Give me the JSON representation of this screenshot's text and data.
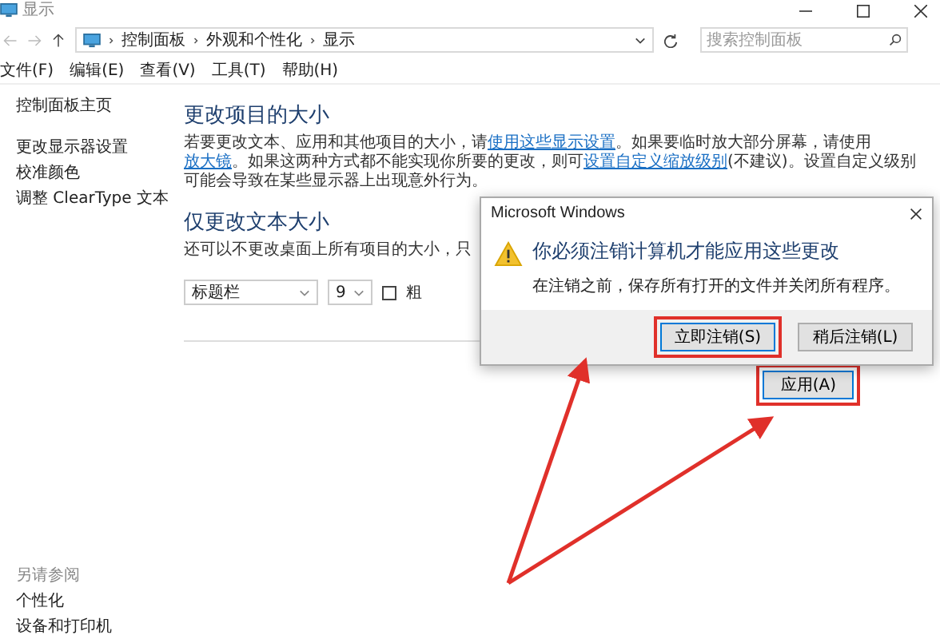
{
  "window": {
    "title": "显示"
  },
  "address_bar": {
    "breadcrumbs": [
      "控制面板",
      "外观和个性化",
      "显示"
    ],
    "search": {
      "placeholder": "搜索控制面板"
    }
  },
  "menu": [
    "文件(F)",
    "编辑(E)",
    "查看(V)",
    "工具(T)",
    "帮助(H)"
  ],
  "sidebar": {
    "items": [
      "控制面板主页",
      "更改显示器设置",
      "校准颜色",
      "调整 ClearType 文本"
    ],
    "see_also": {
      "title": "另请参阅",
      "items": [
        "个性化",
        "设备和打印机"
      ]
    }
  },
  "sections": [
    {
      "title": "更改项目的大小",
      "text": [
        {
          "kind": "text",
          "text": "若要更改文本、应用和其他项目的大小，请"
        },
        {
          "kind": "link",
          "text": "使用这些显示设置"
        },
        {
          "kind": "text",
          "text": "。如果要临时放大部分屏幕，请使用"
        },
        {
          "kind": "link",
          "text": "放大镜"
        },
        {
          "kind": "text",
          "text": "。如果这两种方式都不能实现你所要的更改，则可"
        },
        {
          "kind": "link",
          "text": "设置自定义缩放级别"
        },
        {
          "kind": "text",
          "text": "(不建议)。设置自定义级别可能会导致在某些显示器上出现意外行为。"
        }
      ]
    },
    {
      "title": "仅更改文本大小",
      "text": [
        {
          "kind": "text",
          "text": "还可以不更改桌面上所有项目的大小，只"
        }
      ],
      "controls": {
        "element": "标题栏",
        "size": "9",
        "bold": {
          "label": "粗",
          "checked": false
        }
      }
    }
  ],
  "apply_button": {
    "label": "应用(A)",
    "highlighted": true
  },
  "dialog": {
    "title": "Microsoft Windows",
    "heading": "你必须注销计算机才能应用这些更改",
    "message": "在注销之前，保存所有打开的文件并关闭所有程序。",
    "buttons": [
      {
        "label": "立即注销(S)",
        "highlighted": true
      },
      {
        "label": "稍后注销(L)",
        "highlighted": false
      }
    ]
  }
}
